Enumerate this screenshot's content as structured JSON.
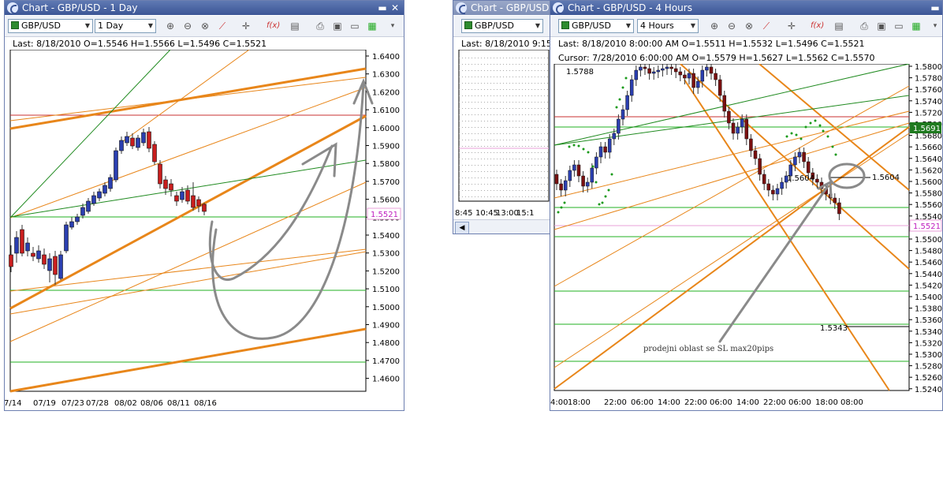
{
  "windows": {
    "left": {
      "title": "Chart - GBP/USD - 1 Day",
      "symbol": "GBP/USD",
      "timeframe": "1 Day",
      "info": "Last: 8/18/2010 O=1.5546 H=1.5566 L=1.5496 C=1.5521",
      "price_tag": "1.5521",
      "y_ticks": [
        "1.6400",
        "1.6300",
        "1.6200",
        "1.6100",
        "1.6000",
        "1.5900",
        "1.5800",
        "1.5700",
        "1.5600",
        "1.5500",
        "1.5400",
        "1.5300",
        "1.5200",
        "1.5100",
        "1.5000",
        "1.4900",
        "1.4800",
        "1.4700",
        "1.4600"
      ],
      "x_ticks": [
        "7/14",
        "07/19",
        "07/23",
        "07/28",
        "08/02",
        "08/06",
        "08/11",
        "08/16"
      ]
    },
    "middle": {
      "title": "Chart - GBP/USD",
      "symbol": "GBP/USD",
      "info": "Last: 8/18/2010 9:15:",
      "x_ticks": [
        "8:45",
        "10:45",
        "13:00",
        "15:1"
      ]
    },
    "right": {
      "title": "Chart - GBP/USD - 4 Hours",
      "symbol": "GBP/USD",
      "timeframe": "4 Hours",
      "info": "Last: 8/18/2010 8:00:00 AM O=1.5511 H=1.5532 L=1.5496 C=1.5521",
      "cursor": "Cursor: 7/28/2010 6:00:00 AM O=1.5579 H=1.5627 L=1.5562 C=1.5570",
      "price_tag": "1.5521",
      "green_tag": "1.5691",
      "labels": {
        "high": "1.5788",
        "level1": "1.5604",
        "level1b": "1.5604",
        "level2": "1.5343",
        "note": "prodejni oblast se SL max20pips"
      },
      "y_ticks": [
        "1.5800",
        "1.5780",
        "1.5760",
        "1.5740",
        "1.5720",
        "1.5700",
        "1.5680",
        "1.5660",
        "1.5640",
        "1.5620",
        "1.5600",
        "1.5580",
        "1.5560",
        "1.5540",
        "1.5520",
        "1.5500",
        "1.5480",
        "1.5460",
        "1.5440",
        "1.5420",
        "1.5400",
        "1.5380",
        "1.5360",
        "1.5340",
        "1.5320",
        "1.5300",
        "1.5280",
        "1.5260",
        "1.5240"
      ],
      "x_ticks": [
        "4:00",
        "18:00",
        "22:00",
        "06:00",
        "14:00",
        "22:00",
        "06:00",
        "14:00",
        "22:00",
        "06:00",
        "18:00",
        "08:00"
      ]
    }
  },
  "colors": {
    "bull": "#2b3fb0",
    "bear": "#c81e1e",
    "trend": "#e8861a",
    "support": "#22b022",
    "resist": "#c83232",
    "annotation": "#8a8a8a",
    "tag_pink": "#e8a0d8"
  }
}
